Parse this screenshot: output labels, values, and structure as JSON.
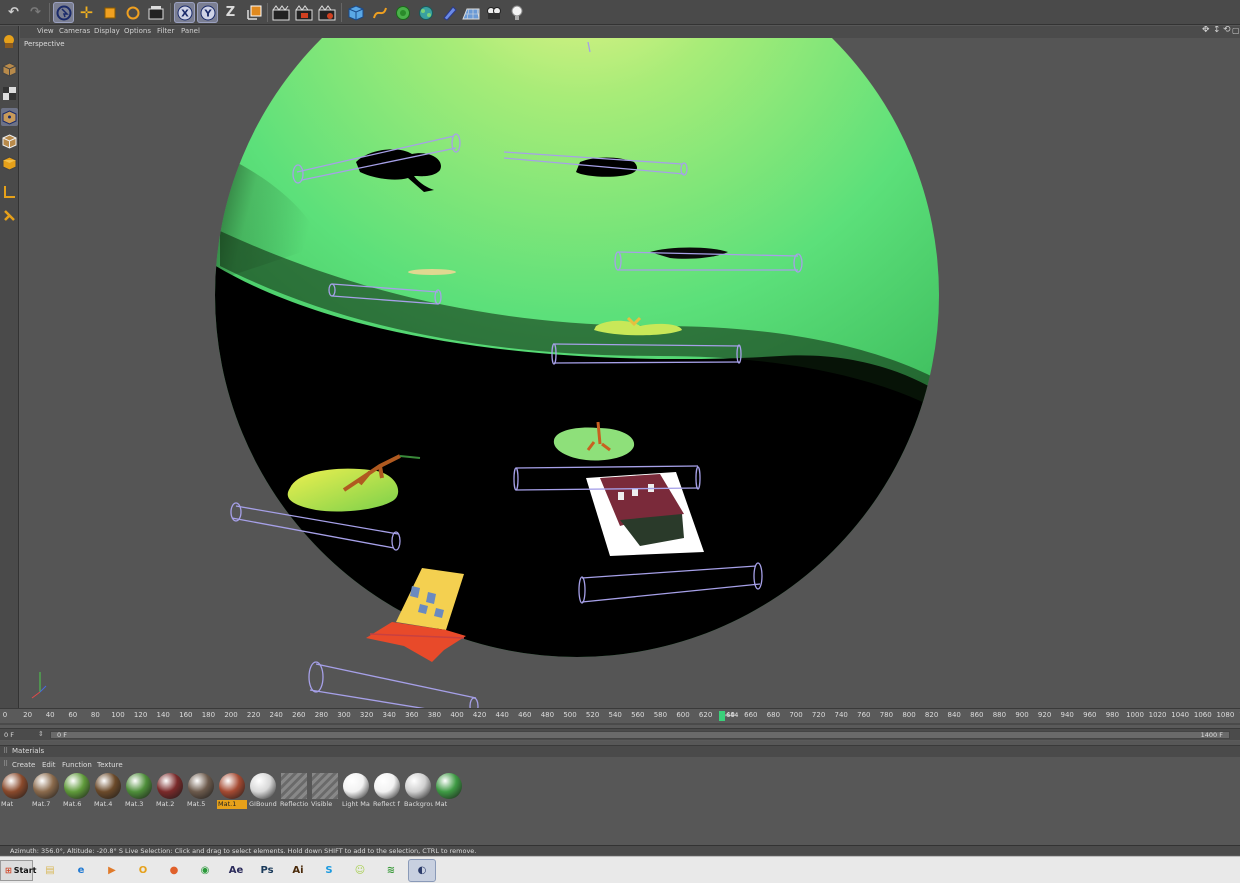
{
  "viewport": {
    "menu": [
      "View",
      "Cameras",
      "Display",
      "Options",
      "Filter",
      "Panel"
    ],
    "label": "Perspective"
  },
  "timeline": {
    "ticks": [
      "0",
      "20",
      "40",
      "60",
      "80",
      "100",
      "120",
      "140",
      "160",
      "180",
      "200",
      "220",
      "240",
      "260",
      "280",
      "300",
      "320",
      "340",
      "360",
      "380",
      "400",
      "420",
      "440",
      "460",
      "480",
      "500",
      "520",
      "540",
      "560",
      "580",
      "600",
      "620",
      "640",
      "660",
      "680",
      "700",
      "720",
      "740",
      "760",
      "780",
      "800",
      "820",
      "840",
      "860",
      "880",
      "900",
      "920",
      "940",
      "960",
      "980",
      "1000",
      "1020",
      "1040",
      "1060",
      "1080",
      "1100"
    ],
    "current_frame_marker": "644",
    "current_frame_field": "0 F",
    "start_frame": "0 F",
    "end_frame": "1400 F"
  },
  "materials": {
    "title": "Materials",
    "menu": [
      "Create",
      "Edit",
      "Function",
      "Texture"
    ],
    "items": [
      {
        "label": "Mat",
        "color": "#8a4a2c",
        "active": false
      },
      {
        "label": "Mat.7",
        "color": "#8a6a4c",
        "active": false
      },
      {
        "label": "Mat.6",
        "color": "#5f9a3a",
        "active": false
      },
      {
        "label": "Mat.4",
        "color": "#6b4a2a",
        "active": false
      },
      {
        "label": "Mat.3",
        "color": "#4e8e3a",
        "active": false
      },
      {
        "label": "Mat.2",
        "color": "#7a2a2a",
        "active": false
      },
      {
        "label": "Mat.5",
        "color": "#6c5a4c",
        "active": false
      },
      {
        "label": "Mat.1",
        "color": "#a54a32",
        "active": true
      },
      {
        "label": "GIBound",
        "color": "#d8d8d8",
        "active": false
      },
      {
        "label": "Reflectio",
        "color": "#7a7a7a",
        "active": false
      },
      {
        "label": "Visible",
        "color": "#7a7a7a",
        "active": false
      },
      {
        "label": "Light Ma",
        "color": "#f2f2f2",
        "active": false
      },
      {
        "label": "Reflect f",
        "color": "#f2f2f2",
        "active": false
      },
      {
        "label": "Backgrou",
        "color": "#d0d0d0",
        "active": false
      },
      {
        "label": "Mat",
        "color": "#3e9a44",
        "active": false
      }
    ]
  },
  "status": {
    "text": "Azimuth: 356.0°, Altitude: -20.8° S   Live Selection: Click and drag to select elements. Hold down SHIFT to add to the selection, CTRL to remove."
  },
  "taskbar": {
    "start_label": "Start",
    "apps": [
      {
        "name": "explorer-icon",
        "glyph": "▤",
        "color": "#d9b95a"
      },
      {
        "name": "internet-explorer-icon",
        "glyph": "e",
        "color": "#1e78d2"
      },
      {
        "name": "media-player-icon",
        "glyph": "▶",
        "color": "#e07a2a"
      },
      {
        "name": "outlook-icon",
        "glyph": "O",
        "color": "#e6a11a"
      },
      {
        "name": "firefox-icon",
        "glyph": "●",
        "color": "#e0602a"
      },
      {
        "name": "chrome-icon",
        "glyph": "◉",
        "color": "#2a9a3a"
      },
      {
        "name": "after-effects-icon",
        "glyph": "Ae",
        "color": "#2a2a5a"
      },
      {
        "name": "photoshop-icon",
        "glyph": "Ps",
        "color": "#1a3a5a"
      },
      {
        "name": "illustrator-icon",
        "glyph": "Ai",
        "color": "#4a2a0a"
      },
      {
        "name": "skype-icon",
        "glyph": "S",
        "color": "#1a9ae0"
      },
      {
        "name": "messenger-icon",
        "glyph": "☺",
        "color": "#a8d050"
      },
      {
        "name": "spotify-icon",
        "glyph": "≋",
        "color": "#3a9a3a"
      },
      {
        "name": "cinema4d-icon",
        "glyph": "◐",
        "color": "#2a3a6a"
      }
    ]
  }
}
